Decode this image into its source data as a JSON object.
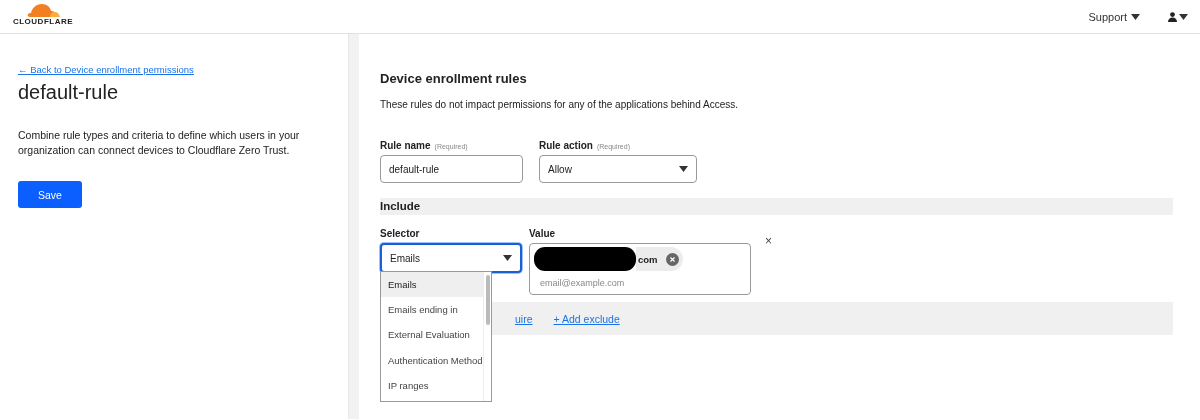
{
  "header": {
    "logo": "CLOUDFLARE",
    "menu": "Support"
  },
  "side": {
    "back_link": "← Back to Device enrollment permissions",
    "title": "default-rule",
    "description": "Combine rule types and criteria to define which users in your organization can connect devices to Cloudflare Zero Trust.",
    "save": "Save"
  },
  "main": {
    "heading": "Device enrollment rules",
    "subtitle": "These rules do not impact permissions for any of the applications behind Access.",
    "rule_name": {
      "label": "Rule name",
      "hint": "(Required)",
      "value": "default-rule"
    },
    "rule_action": {
      "label": "Rule action",
      "hint": "(Required)",
      "value": "Allow"
    },
    "include": {
      "title": "Include",
      "selector_label": "Selector",
      "selector_value": "Emails",
      "value_label": "Value",
      "chip": "com",
      "placeholder": "email@example.com",
      "remove": "×"
    },
    "links": [
      "uire",
      "+ Add exclude"
    ],
    "dropdown": [
      {
        "label": "Emails",
        "selected": true
      },
      {
        "label": "Emails ending in",
        "selected": false
      },
      {
        "label": "External Evaluation",
        "selected": false
      },
      {
        "label": "Authentication Method",
        "selected": false
      },
      {
        "label": "IP ranges",
        "selected": false
      }
    ]
  }
}
